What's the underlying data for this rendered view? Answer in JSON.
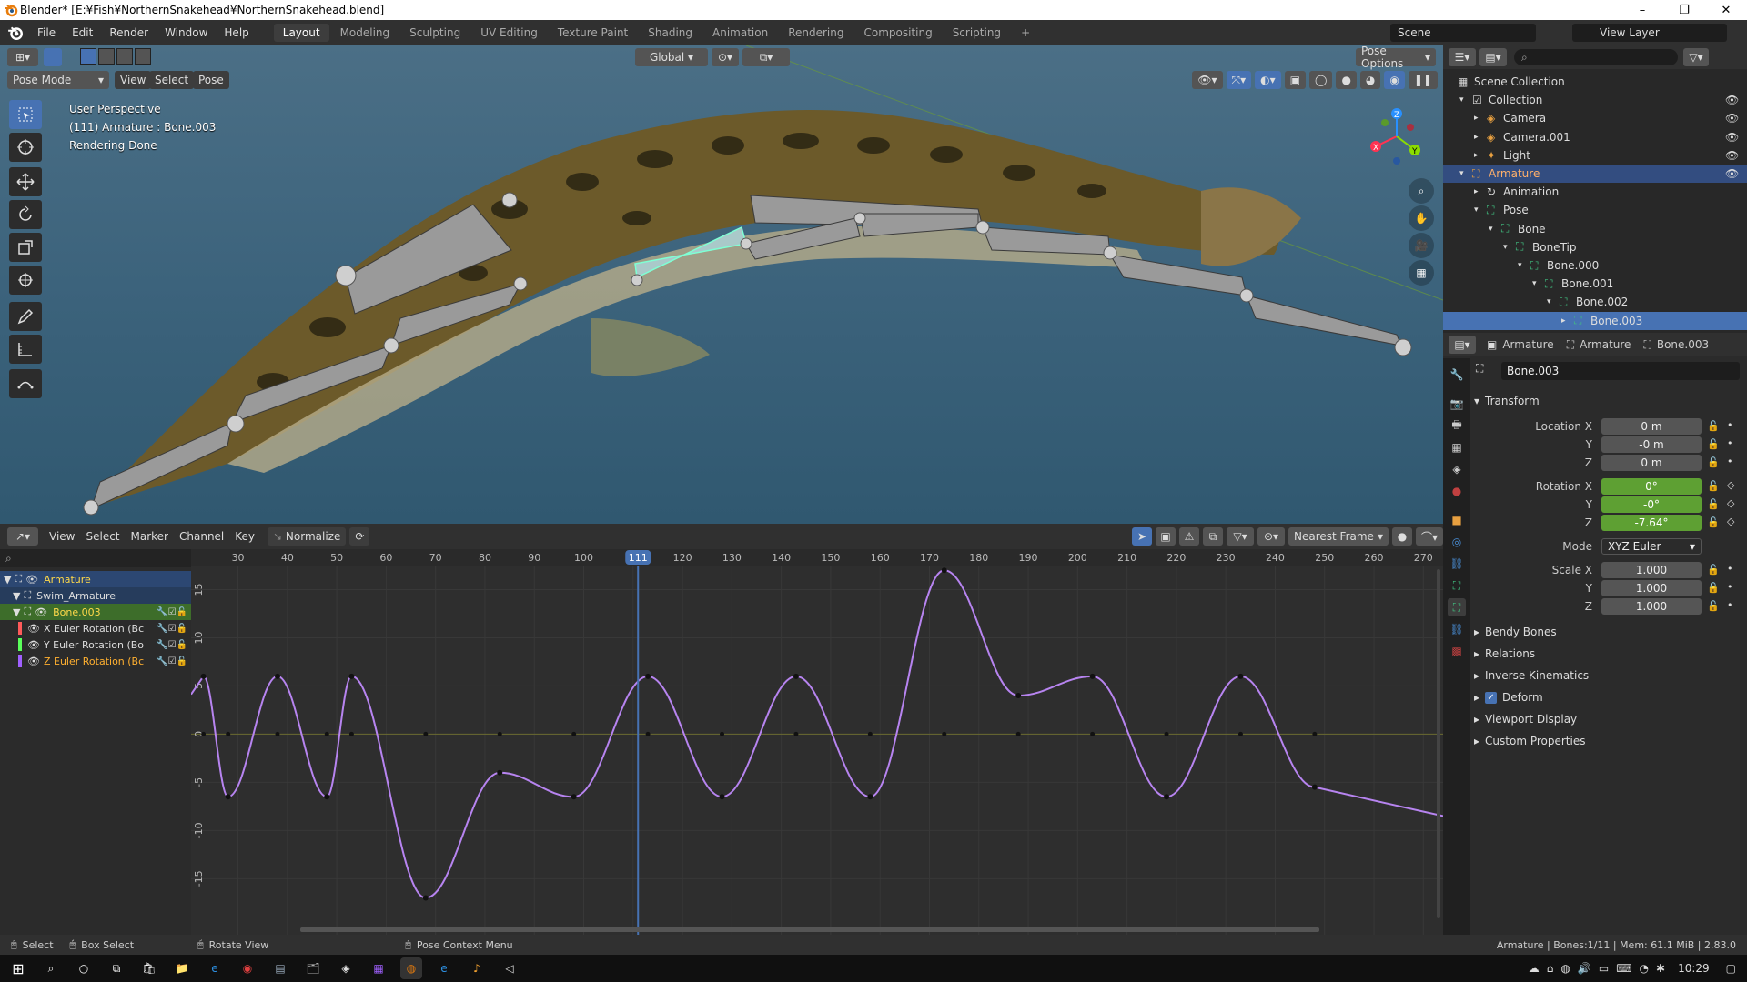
{
  "window": {
    "title": "Blender* [E:¥Fish¥NorthernSnakehead¥NorthernSnakehead.blend]"
  },
  "menubar": {
    "menus": [
      "File",
      "Edit",
      "Render",
      "Window",
      "Help"
    ],
    "workspaces": [
      "Layout",
      "Modeling",
      "Sculpting",
      "UV Editing",
      "Texture Paint",
      "Shading",
      "Animation",
      "Rendering",
      "Compositing",
      "Scripting"
    ],
    "active_workspace": "Layout",
    "add_tab": "+",
    "scene_label": "Scene",
    "viewlayer_label": "View Layer"
  },
  "viewport": {
    "mode": "Pose Mode",
    "menus": [
      "View",
      "Select",
      "Pose"
    ],
    "transform_orientation": "Global",
    "pose_options": "Pose Options",
    "overlay_lines": [
      "User Perspective",
      "(111) Armature : Bone.003",
      "Rendering Done"
    ],
    "gizmo": {
      "x": "X",
      "y": "Y",
      "z": "Z"
    }
  },
  "graph_editor": {
    "menus": [
      "View",
      "Select",
      "Marker",
      "Channel",
      "Key"
    ],
    "normalize": "Normalize",
    "snap": "Nearest Frame",
    "current_frame": 111,
    "frame_ticks": [
      30,
      40,
      50,
      60,
      70,
      80,
      90,
      100,
      120,
      130,
      140,
      150,
      160,
      170,
      180,
      190,
      200,
      210,
      220,
      230,
      240,
      250,
      260,
      270
    ],
    "value_ticks": [
      "15",
      "10",
      "5",
      "0",
      "-5",
      "-10",
      "-15"
    ],
    "channels": [
      {
        "label": "Armature",
        "color": "#7fb0ff"
      },
      {
        "label": "Swim_Armature",
        "color": "#a8c8f0"
      },
      {
        "label": "Bone.003",
        "color": "#ffd94a"
      },
      {
        "label": "X Euler Rotation (Bc",
        "color": "#ff5a5a"
      },
      {
        "label": "Y Euler Rotation (Bo",
        "color": "#5aff5a"
      },
      {
        "label": "Z Euler Rotation (Bc",
        "color": "#a060ff"
      }
    ],
    "curve": {
      "color": "#b784f0",
      "keyframes": [
        [
          23,
          6
        ],
        [
          28,
          -6.5
        ],
        [
          38,
          6
        ],
        [
          48,
          -6.5
        ],
        [
          53,
          6
        ],
        [
          68,
          -17
        ],
        [
          83,
          -4
        ],
        [
          98,
          -6.5
        ],
        [
          113,
          6
        ],
        [
          128,
          -6.5
        ],
        [
          143,
          6
        ],
        [
          158,
          -6.5
        ],
        [
          173,
          17
        ],
        [
          188,
          4
        ],
        [
          203,
          6
        ],
        [
          218,
          -6.5
        ],
        [
          233,
          6
        ],
        [
          248,
          -5.5
        ]
      ]
    }
  },
  "outliner": {
    "rows": [
      {
        "label": "Scene Collection",
        "indent": 0
      },
      {
        "label": "Collection",
        "indent": 1
      },
      {
        "label": "Camera",
        "indent": 2
      },
      {
        "label": "Camera.001",
        "indent": 2
      },
      {
        "label": "Light",
        "indent": 2
      },
      {
        "label": "Armature",
        "indent": 1,
        "selected": true
      },
      {
        "label": "Animation",
        "indent": 2
      },
      {
        "label": "Pose",
        "indent": 2
      },
      {
        "label": "Bone",
        "indent": 3
      },
      {
        "label": "BoneTip",
        "indent": 4
      },
      {
        "label": "Bone.000",
        "indent": 5
      },
      {
        "label": "Bone.001",
        "indent": 6
      },
      {
        "label": "Bone.002",
        "indent": 7
      },
      {
        "label": "Bone.003",
        "indent": 8,
        "active": true
      }
    ]
  },
  "properties": {
    "breadcrumb": [
      "Armature",
      "Armature",
      "Bone.003"
    ],
    "bone_name": "Bone.003",
    "transform_label": "Transform",
    "location_label": "Location X",
    "location": [
      "0 m",
      "-0 m",
      "0 m"
    ],
    "rotation_label": "Rotation X",
    "rotation": [
      "0°",
      "-0°",
      "-7.64°"
    ],
    "axis_labels": [
      "Y",
      "Z"
    ],
    "mode_label": "Mode",
    "mode": "XYZ Euler",
    "scale_label": "Scale X",
    "scale": [
      "1.000",
      "1.000",
      "1.000"
    ],
    "panels": [
      "Bendy Bones",
      "Relations",
      "Inverse Kinematics",
      "Deform",
      "Viewport Display",
      "Custom Properties"
    ]
  },
  "statusbar": {
    "items": [
      "Select",
      "Box Select",
      "Rotate View",
      "Pose Context Menu"
    ],
    "info": "Armature | Bones:1/11 | Mem: 61.1 MiB | 2.83.0"
  },
  "taskbar": {
    "time": "10:29"
  }
}
